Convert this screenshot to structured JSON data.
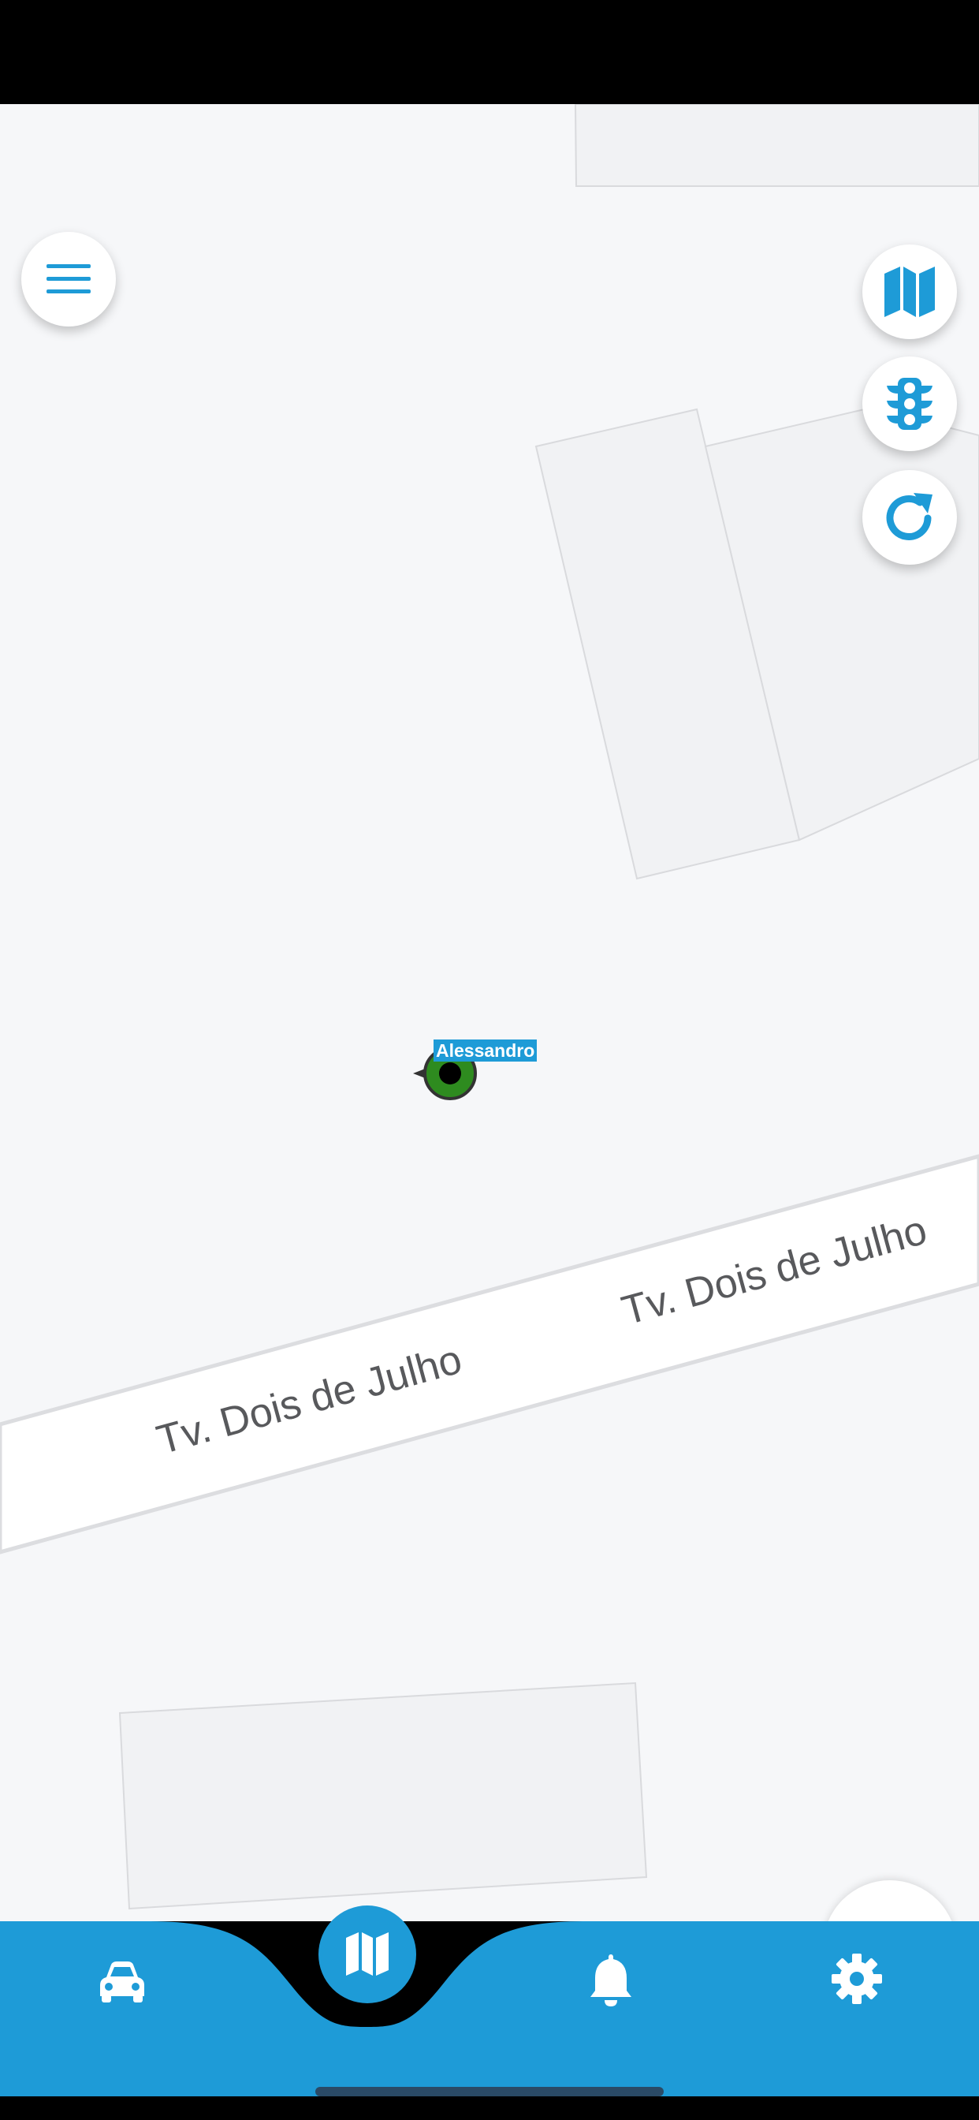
{
  "colors": {
    "accent": "#1e9bd7",
    "map_background": "#f6f7f9",
    "road": "#ffffff",
    "marker_green": "#2e8b1f"
  },
  "map": {
    "street_labels": [
      "Tv. Dois de Julho",
      "Tv. Dois de Julho"
    ],
    "vehicle_marker": {
      "label": "Alessandro",
      "status_color": "#2e8b1f"
    }
  },
  "controls": {
    "menu": {
      "icon": "hamburger-menu-icon"
    },
    "map_type": {
      "icon": "map-icon"
    },
    "traffic": {
      "icon": "traffic-light-icon"
    },
    "refresh": {
      "icon": "refresh-icon"
    }
  },
  "bottom_nav": {
    "items": [
      {
        "icon": "car-icon"
      },
      {
        "icon": "map-icon",
        "active": true
      },
      {
        "icon": "bell-icon"
      },
      {
        "icon": "gear-icon"
      }
    ]
  }
}
